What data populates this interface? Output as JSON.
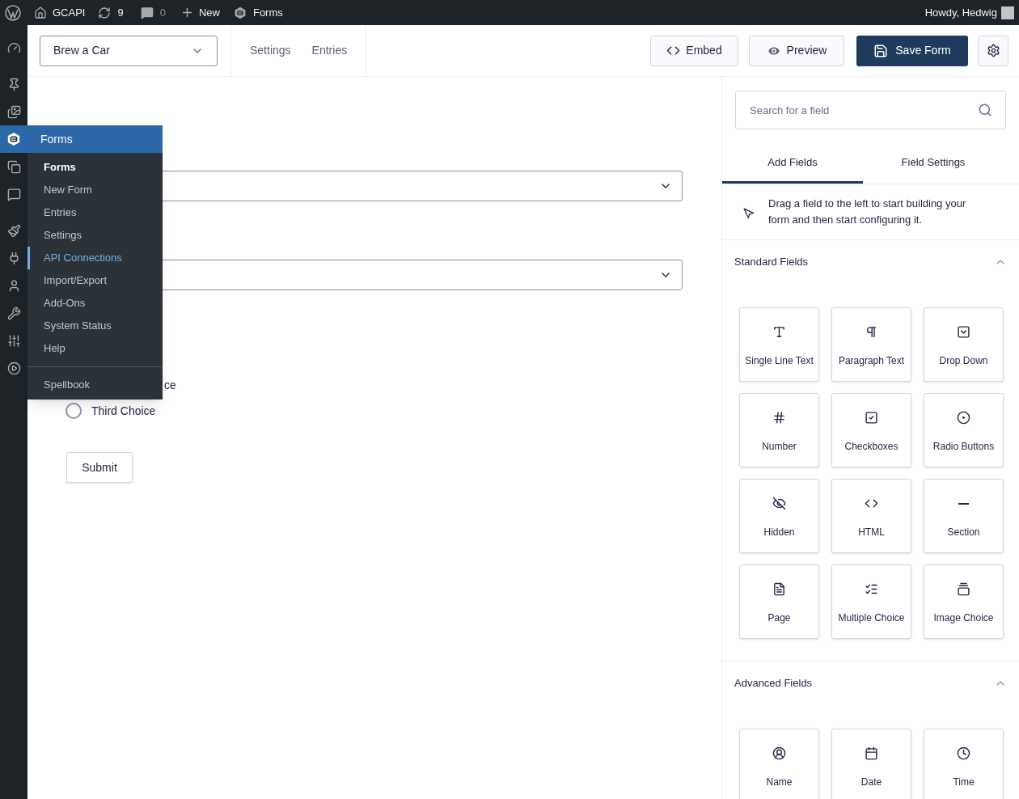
{
  "admin_bar": {
    "site": "GCAPI",
    "updates": "9",
    "comments": "0",
    "new": "New",
    "forms": "Forms",
    "greeting": "Howdy, Hedwig"
  },
  "sidebar": {
    "items": [
      {
        "kind": "dashboard",
        "selected": false
      },
      {
        "kind": "posts",
        "selected": false
      },
      {
        "kind": "media",
        "selected": false
      },
      {
        "kind": "forms",
        "selected": true
      },
      {
        "kind": "pages",
        "selected": false
      },
      {
        "kind": "comments",
        "selected": false
      },
      {
        "kind": "appearance",
        "selected": false
      },
      {
        "kind": "plugins",
        "selected": false
      },
      {
        "kind": "users",
        "selected": false
      },
      {
        "kind": "tools",
        "selected": false
      },
      {
        "kind": "settings",
        "selected": false
      },
      {
        "kind": "media_player",
        "selected": false
      }
    ]
  },
  "flyout": {
    "title": "Forms",
    "groups": [
      [
        {
          "label": "Forms",
          "current": true,
          "selected": false
        },
        {
          "label": "New Form",
          "current": false,
          "selected": false
        },
        {
          "label": "Entries",
          "current": false,
          "selected": false
        },
        {
          "label": "Settings",
          "current": false,
          "selected": false
        },
        {
          "label": "API Connections",
          "current": false,
          "selected": true
        },
        {
          "label": "Import/Export",
          "current": false,
          "selected": false
        },
        {
          "label": "Add-Ons",
          "current": false,
          "selected": false
        },
        {
          "label": "System Status",
          "current": false,
          "selected": false
        },
        {
          "label": "Help",
          "current": false,
          "selected": false
        }
      ],
      [
        {
          "label": "Spellbook",
          "current": false,
          "selected": false
        }
      ]
    ]
  },
  "header": {
    "form_select": "Brew a Car",
    "links": [
      "Settings",
      "Entries"
    ],
    "embed": "Embed",
    "preview": "Preview",
    "save": "Save Form"
  },
  "canvas": {
    "choices": [
      {
        "label": "ce"
      },
      {
        "label": "Third Choice",
        "selected": false
      }
    ],
    "submit": "Submit"
  },
  "panel": {
    "search": {
      "placeholder": "Search for a field"
    },
    "tabs": [
      {
        "label": "Add Fields",
        "selected": true
      },
      {
        "label": "Field Settings",
        "selected": false
      }
    ],
    "hint": "Drag a field to the left to start building your form and then start configuring it.",
    "sections": [
      {
        "title": "Standard Fields",
        "expanded": true,
        "fields": [
          {
            "label": "Single Line Text",
            "kind": "text"
          },
          {
            "label": "Paragraph Text",
            "kind": "paragraph"
          },
          {
            "label": "Drop Down",
            "kind": "dropdown"
          },
          {
            "label": "Number",
            "kind": "number"
          },
          {
            "label": "Checkboxes",
            "kind": "checkbox"
          },
          {
            "label": "Radio Buttons",
            "kind": "radio"
          },
          {
            "label": "Hidden",
            "kind": "hidden"
          },
          {
            "label": "HTML",
            "kind": "html"
          },
          {
            "label": "Section",
            "kind": "section"
          },
          {
            "label": "Page",
            "kind": "page"
          },
          {
            "label": "Multiple Choice",
            "kind": "multiple_choice"
          },
          {
            "label": "Image Choice",
            "kind": "image_choice"
          }
        ]
      },
      {
        "title": "Advanced Fields",
        "expanded": true,
        "fields": [
          {
            "label": "Name",
            "kind": "name"
          },
          {
            "label": "Date",
            "kind": "date"
          },
          {
            "label": "Time",
            "kind": "time"
          }
        ]
      }
    ]
  }
}
